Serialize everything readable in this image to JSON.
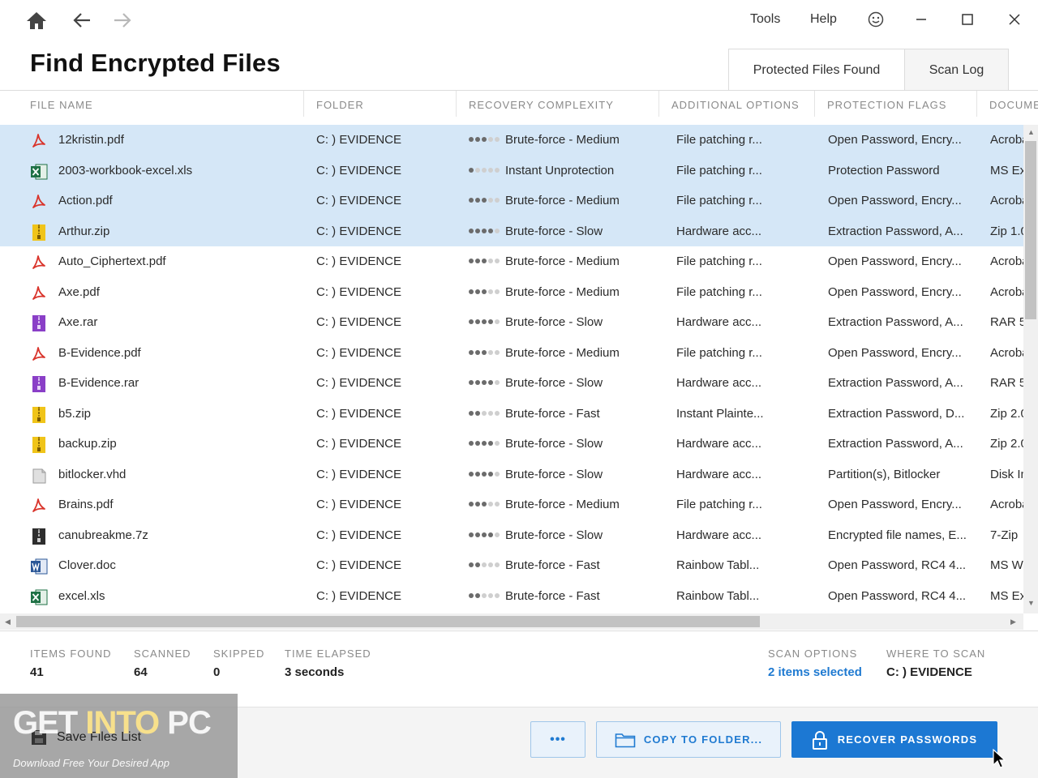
{
  "topbar": {
    "menu_tools": "Tools",
    "menu_help": "Help"
  },
  "page": {
    "title": "Find Encrypted Files"
  },
  "tabs": [
    {
      "label": "Protected Files Found",
      "active": true
    },
    {
      "label": "Scan Log",
      "active": false
    }
  ],
  "columns": [
    "FILE NAME",
    "FOLDER",
    "RECOVERY COMPLEXITY",
    "ADDITIONAL OPTIONS",
    "PROTECTION FLAGS",
    "DOCUMENT"
  ],
  "rows": [
    {
      "name": "12kristin.pdf",
      "icon": "pdf-icon",
      "folder": "C: ) EVIDENCE",
      "complexity_level": 3,
      "complexity": "Brute-force - Medium",
      "options": "File patching r...",
      "flags": "Open Password, Encry...",
      "doc": "Acrobat",
      "selected": true
    },
    {
      "name": "2003-workbook-excel.xls",
      "icon": "excel-icon",
      "folder": "C: ) EVIDENCE",
      "complexity_level": 1,
      "complexity": "Instant Unprotection",
      "options": "File patching r...",
      "flags": "Protection Password",
      "doc": "MS Excel",
      "selected": true
    },
    {
      "name": "Action.pdf",
      "icon": "pdf-icon",
      "folder": "C: ) EVIDENCE",
      "complexity_level": 3,
      "complexity": "Brute-force - Medium",
      "options": "File patching r...",
      "flags": "Open Password, Encry...",
      "doc": "Acrobat",
      "selected": true
    },
    {
      "name": "Arthur.zip",
      "icon": "zip-icon",
      "folder": "C: ) EVIDENCE",
      "complexity_level": 4,
      "complexity": "Brute-force - Slow",
      "options": "Hardware acc...",
      "flags": "Extraction Password, A...",
      "doc": "Zip 1.0",
      "selected": true
    },
    {
      "name": "Auto_Ciphertext.pdf",
      "icon": "pdf-icon",
      "folder": "C: ) EVIDENCE",
      "complexity_level": 3,
      "complexity": "Brute-force - Medium",
      "options": "File patching r...",
      "flags": "Open Password, Encry...",
      "doc": "Acrobat",
      "selected": false
    },
    {
      "name": "Axe.pdf",
      "icon": "pdf-icon",
      "folder": "C: ) EVIDENCE",
      "complexity_level": 3,
      "complexity": "Brute-force - Medium",
      "options": "File patching r...",
      "flags": "Open Password, Encry...",
      "doc": "Acrobat",
      "selected": false
    },
    {
      "name": "Axe.rar",
      "icon": "rar-icon",
      "folder": "C: ) EVIDENCE",
      "complexity_level": 4,
      "complexity": "Brute-force - Slow",
      "options": "Hardware acc...",
      "flags": "Extraction Password, A...",
      "doc": "RAR 5",
      "selected": false
    },
    {
      "name": "B-Evidence.pdf",
      "icon": "pdf-icon",
      "folder": "C: ) EVIDENCE",
      "complexity_level": 3,
      "complexity": "Brute-force - Medium",
      "options": "File patching r...",
      "flags": "Open Password, Encry...",
      "doc": "Acrobat",
      "selected": false
    },
    {
      "name": "B-Evidence.rar",
      "icon": "rar-icon",
      "folder": "C: ) EVIDENCE",
      "complexity_level": 4,
      "complexity": "Brute-force - Slow",
      "options": "Hardware acc...",
      "flags": "Extraction Password, A...",
      "doc": "RAR 5",
      "selected": false
    },
    {
      "name": "b5.zip",
      "icon": "zip-icon",
      "folder": "C: ) EVIDENCE",
      "complexity_level": 2,
      "complexity": "Brute-force - Fast",
      "options": "Instant Plainte...",
      "flags": "Extraction Password, D...",
      "doc": "Zip 2.0",
      "selected": false
    },
    {
      "name": "backup.zip",
      "icon": "zip-icon",
      "folder": "C: ) EVIDENCE",
      "complexity_level": 4,
      "complexity": "Brute-force - Slow",
      "options": "Hardware acc...",
      "flags": "Extraction Password, A...",
      "doc": "Zip 2.0",
      "selected": false
    },
    {
      "name": "bitlocker.vhd",
      "icon": "disk-image-icon",
      "folder": "C: ) EVIDENCE",
      "complexity_level": 4,
      "complexity": "Brute-force - Slow",
      "options": "Hardware acc...",
      "flags": "Partition(s), Bitlocker",
      "doc": "Disk Image",
      "selected": false
    },
    {
      "name": "Brains.pdf",
      "icon": "pdf-icon",
      "folder": "C: ) EVIDENCE",
      "complexity_level": 3,
      "complexity": "Brute-force - Medium",
      "options": "File patching r...",
      "flags": "Open Password, Encry...",
      "doc": "Acrobat",
      "selected": false
    },
    {
      "name": "canubreakme.7z",
      "icon": "sevenzip-icon",
      "folder": "C: ) EVIDENCE",
      "complexity_level": 4,
      "complexity": "Brute-force - Slow",
      "options": "Hardware acc...",
      "flags": "Encrypted file names, E...",
      "doc": "7-Zip",
      "selected": false
    },
    {
      "name": "Clover.doc",
      "icon": "word-icon",
      "folder": "C: ) EVIDENCE",
      "complexity_level": 2,
      "complexity": "Brute-force - Fast",
      "options": "Rainbow Tabl...",
      "flags": "Open Password, RC4 4...",
      "doc": "MS Word",
      "selected": false
    },
    {
      "name": "excel.xls",
      "icon": "excel-icon",
      "folder": "C: ) EVIDENCE",
      "complexity_level": 2,
      "complexity": "Brute-force - Fast",
      "options": "Rainbow Tabl...",
      "flags": "Open Password, RC4 4...",
      "doc": "MS Excel",
      "selected": false
    }
  ],
  "stats": {
    "items_found_label": "ITEMS FOUND",
    "items_found": "41",
    "scanned_label": "SCANNED",
    "scanned": "64",
    "skipped_label": "SKIPPED",
    "skipped": "0",
    "time_label": "TIME ELAPSED",
    "time": "3 seconds",
    "scan_options_label": "SCAN OPTIONS",
    "scan_options": "2 items selected",
    "where_label": "WHERE TO SCAN",
    "where": "C: ) EVIDENCE"
  },
  "footer": {
    "save_list": "Save Files List",
    "more_label": "•••",
    "copy_label": "COPY TO FOLDER...",
    "recover_label": "RECOVER PASSWORDS"
  },
  "watermark": {
    "word1": "GET ",
    "word2": "INTO",
    "word3": " PC",
    "subtitle": "Download Free Your Desired App"
  },
  "colors": {
    "accent": "#1c78d3",
    "selected_row": "#d5e7f7",
    "pdf": "#d9342b",
    "excel": "#1e7145",
    "word": "#2b5797",
    "rar": "#8a3fc7",
    "zip": "#f0c419"
  }
}
